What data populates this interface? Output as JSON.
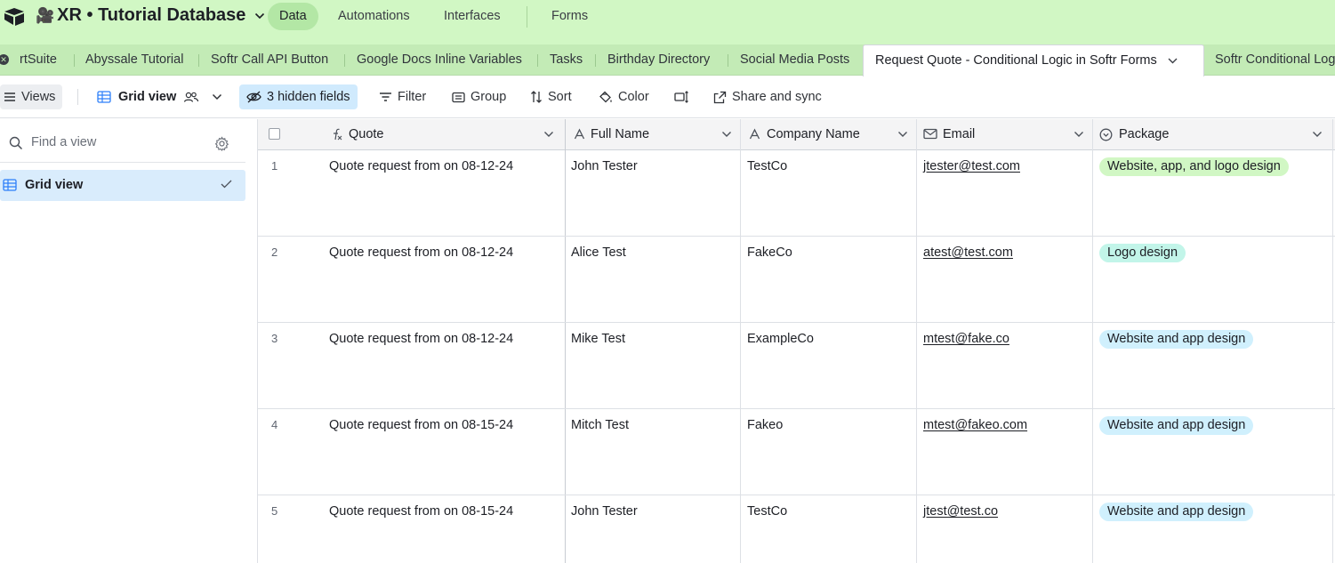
{
  "header": {
    "base_emoji": "🎥",
    "base_title": "XR • Tutorial Database",
    "nav": [
      "Data",
      "Automations",
      "Interfaces",
      "Forms"
    ]
  },
  "tabs": {
    "items": [
      "rtSuite",
      "Abyssale Tutorial",
      "Softr Call API Button",
      "Google Docs Inline Variables",
      "Tasks",
      "Birthday Directory",
      "Social Media Posts",
      "Request Quote - Conditional Logic in Softr Forms",
      "Softr Conditional Log"
    ],
    "active_index": 7
  },
  "toolbar": {
    "views_label": "Views",
    "view_name": "Grid view",
    "hidden_fields": "3 hidden fields",
    "filter": "Filter",
    "group": "Group",
    "sort": "Sort",
    "color": "Color",
    "share": "Share and sync"
  },
  "sidebar": {
    "search_placeholder": "Find a view",
    "views": [
      {
        "label": "Grid view",
        "selected": true
      }
    ]
  },
  "grid": {
    "columns": [
      {
        "label": "Quote",
        "icon": "formula-icon"
      },
      {
        "label": "Full Name",
        "icon": "text-field-icon"
      },
      {
        "label": "Company Name",
        "icon": "text-field-icon"
      },
      {
        "label": "Email",
        "icon": "email-field-icon"
      },
      {
        "label": "Package",
        "icon": "single-select-icon"
      }
    ],
    "rows": [
      {
        "num": "1",
        "quote": "Quote request from  on 08-12-24",
        "name": "John Tester",
        "company": "TestCo",
        "email": "jtester@test.com",
        "package": "Website, app, and logo design",
        "package_color": "#d1f7c4"
      },
      {
        "num": "2",
        "quote": "Quote request from  on 08-12-24",
        "name": "Alice Test",
        "company": "FakeCo",
        "email": "atest@test.com",
        "package": "Logo design",
        "package_color": "#c2f5e9"
      },
      {
        "num": "3",
        "quote": "Quote request from  on 08-12-24",
        "name": "Mike Test",
        "company": "ExampleCo",
        "email": "mtest@fake.co",
        "package": "Website and app design",
        "package_color": "#d0f0fd"
      },
      {
        "num": "4",
        "quote": "Quote request from  on 08-15-24",
        "name": "Mitch Test",
        "company": "Fakeo",
        "email": "mtest@fakeo.com",
        "package": "Website and app design",
        "package_color": "#d0f0fd"
      },
      {
        "num": "5",
        "quote": "Quote request from  on 08-15-24",
        "name": "John Tester",
        "company": "TestCo",
        "email": "jtest@test.co",
        "package": "Website and app design",
        "package_color": "#d0f0fd"
      }
    ]
  }
}
